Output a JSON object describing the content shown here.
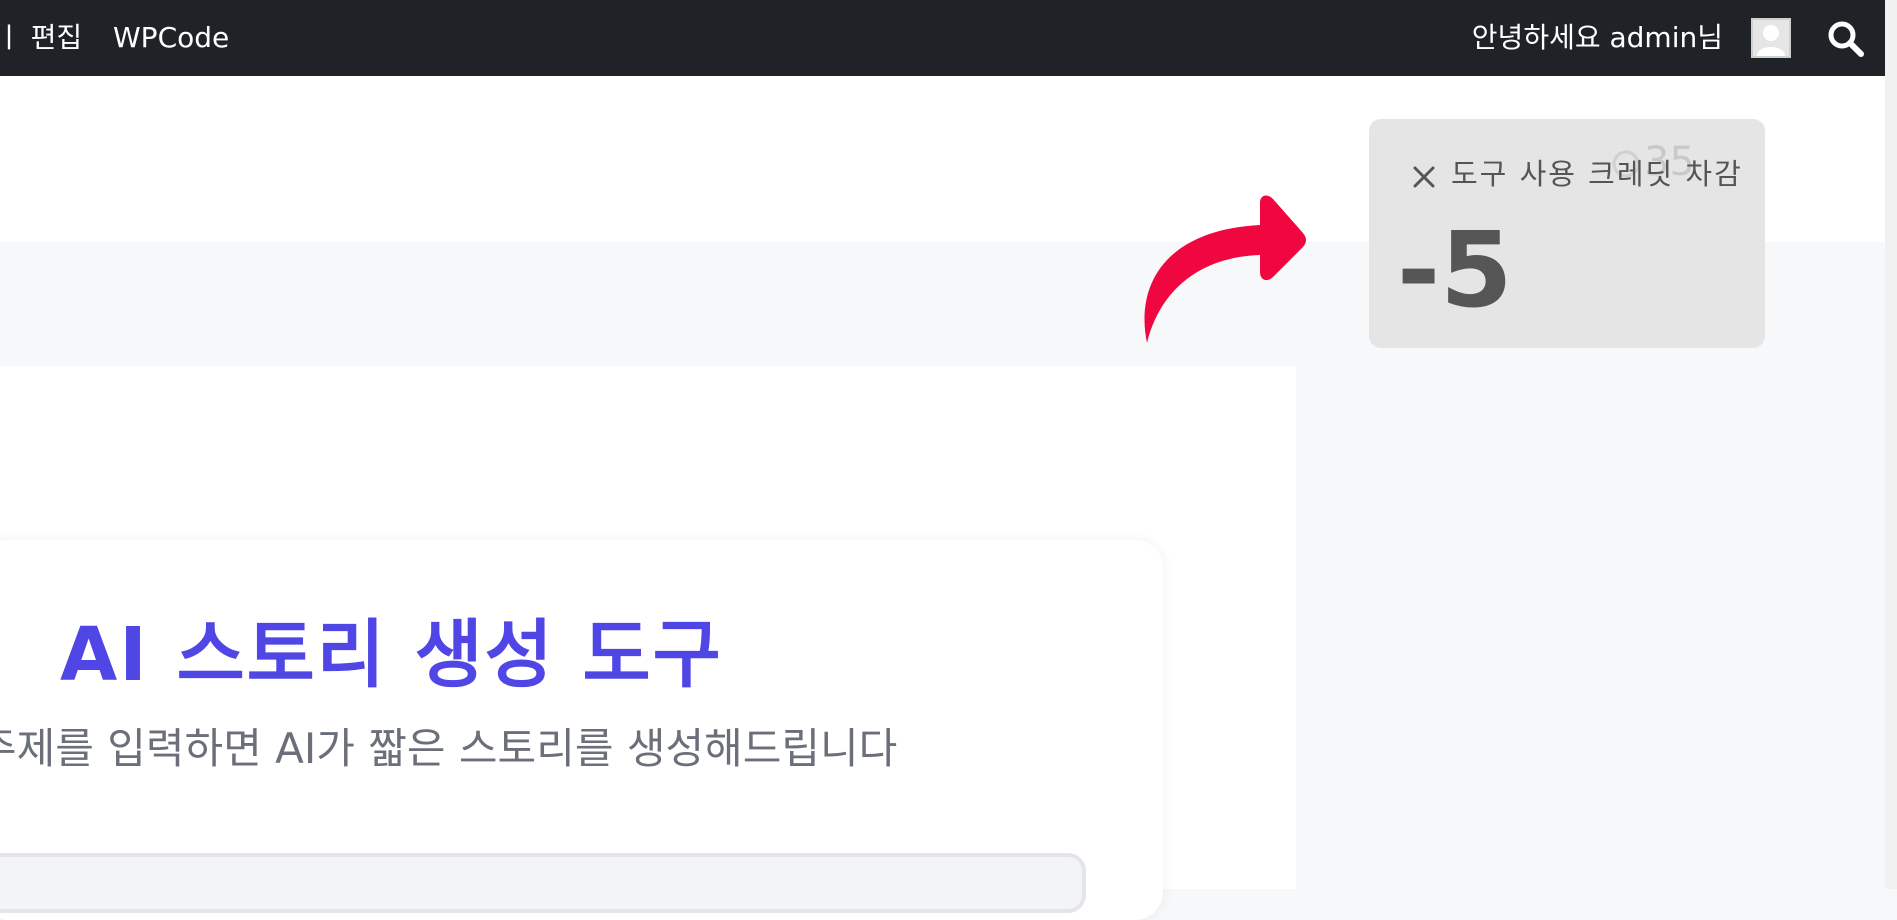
{
  "admin_bar": {
    "edit_label": "ㅣ 편집",
    "wpcode_label": "WPCode",
    "greeting": "안녕하세요 admin님",
    "avatar_icon": "user-avatar-icon",
    "search_icon": "search-icon"
  },
  "credit_toast": {
    "ghost_count": "35",
    "close_icon": "close-icon",
    "label": "도구 사용 크레딧 차감",
    "value": "-5",
    "arrow_color": "#f0073f"
  },
  "tool": {
    "title": "AI 스토리 생성 도구",
    "subtitle": "주제를 입력하면 AI가 짧은 스토리를 생성해드립니다",
    "title_color": "#4f46e5"
  }
}
